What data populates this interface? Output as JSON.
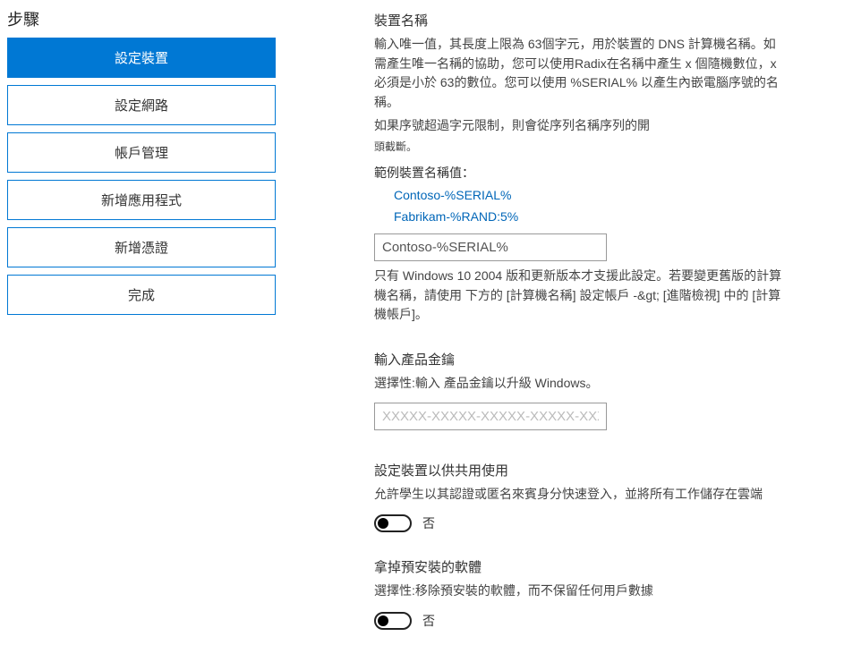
{
  "sidebar": {
    "title": "步驟",
    "steps": [
      {
        "label": "設定裝置"
      },
      {
        "label": "設定網路"
      },
      {
        "label": "帳戶管理"
      },
      {
        "label": "新增應用程式"
      },
      {
        "label": "新增憑證"
      },
      {
        "label": "完成"
      }
    ]
  },
  "deviceName": {
    "title": "裝置名稱",
    "desc1": "輸入唯一值，其長度上限為 63個字元，用於裝置的 DNS 計算機名稱。如需產生唯一名稱的協助，您可以使用Radix在名稱中產生 x 個隨機數位，x 必須是小於 63的數位。您可以使用 %SERIAL% 以產生內嵌電腦序號的名稱。",
    "desc2": "如果序號超過字元限制，則會從序列名稱序列的開",
    "desc3": "頭截斷。",
    "exampleLabel": "範例裝置名稱值：",
    "example1": "Contoso-%SERIAL%",
    "example2": "Fabrikam-%RAND:5%",
    "inputValue": "Contoso-%SERIAL%",
    "note": "只有 Windows 10 2004 版和更新版本才支援此設定。若要變更舊版的計算機名稱，請使用 下方的 [計算機名稱] 設定帳戶 -&gt; [進階檢視] 中的 [計算機帳戶]。"
  },
  "productKey": {
    "title": "輸入產品金鑰",
    "desc": "選擇性:輸入 產品金鑰以升級 Windows。",
    "placeholder": "XXXXX-XXXXX-XXXXX-XXXXX-XXXXX"
  },
  "sharedUse": {
    "title": "設定裝置以供共用使用",
    "desc": "允許學生以其認證或匿名來賓身分快速登入，並將所有工作儲存在雲端",
    "toggleLabel": "否"
  },
  "removePreinstalled": {
    "title": "拿掉預安裝的軟體",
    "desc": "選擇性:移除預安裝的軟體，而不保留任何用戶數據",
    "toggleLabel": "否"
  }
}
